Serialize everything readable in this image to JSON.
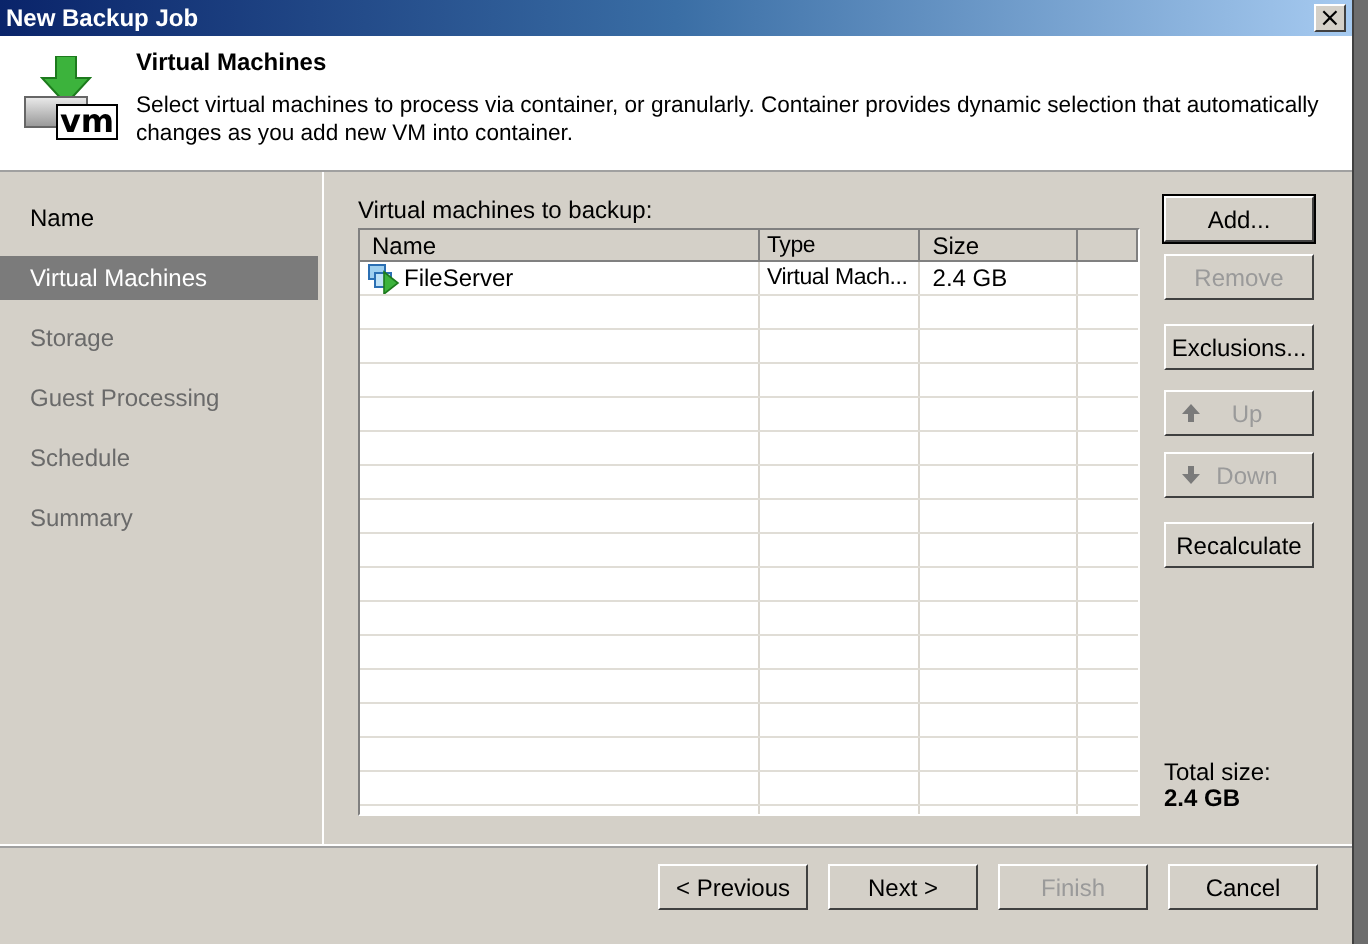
{
  "window": {
    "title": "New Backup Job",
    "close": "×"
  },
  "header": {
    "title": "Virtual Machines",
    "description": "Select virtual machines to process via container, or granularly. Container provides dynamic selection that automatically changes as you add new VM into container.",
    "icon_label": "vm"
  },
  "steps": [
    {
      "label": "Name",
      "selected": false
    },
    {
      "label": "Virtual Machines",
      "selected": true
    },
    {
      "label": "Storage",
      "selected": false
    },
    {
      "label": "Guest Processing",
      "selected": false
    },
    {
      "label": "Schedule",
      "selected": false
    },
    {
      "label": "Summary",
      "selected": false
    }
  ],
  "table": {
    "label": "Virtual machines to backup:",
    "columns": [
      "Name",
      "Type",
      "Size"
    ],
    "rows": [
      {
        "name": "FileServer",
        "type": "Virtual Mach...",
        "size": "2.4 GB"
      }
    ]
  },
  "side_buttons": [
    {
      "label": "Add...",
      "disabled": false,
      "default": true,
      "kind": "plain"
    },
    {
      "label": "Remove",
      "disabled": true,
      "default": false,
      "kind": "plain"
    },
    {
      "label": "Exclusions...",
      "disabled": false,
      "default": false,
      "kind": "plain"
    },
    {
      "label": "Up",
      "disabled": true,
      "default": false,
      "kind": "up"
    },
    {
      "label": "Down",
      "disabled": true,
      "default": false,
      "kind": "down"
    },
    {
      "label": "Recalculate",
      "disabled": false,
      "default": false,
      "kind": "plain"
    }
  ],
  "total": {
    "label": "Total size:",
    "value": "2.4 GB"
  },
  "footer_buttons": [
    {
      "label": "< Previous",
      "disabled": false
    },
    {
      "label": "Next >",
      "disabled": false
    },
    {
      "label": "Finish",
      "disabled": true
    },
    {
      "label": "Cancel",
      "disabled": false
    }
  ]
}
